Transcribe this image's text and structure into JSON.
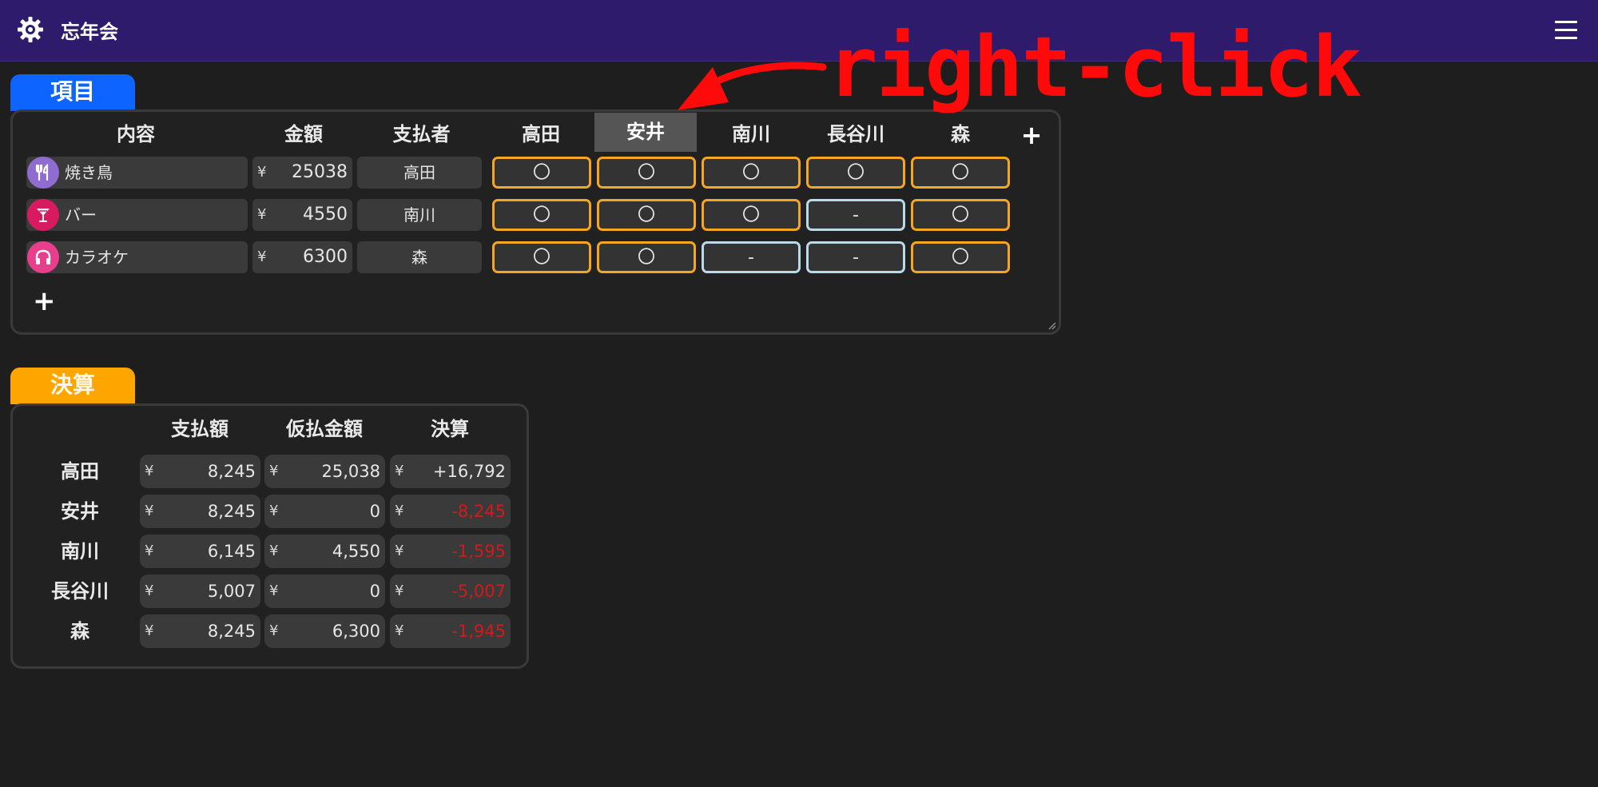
{
  "header": {
    "title": "忘年会",
    "settings_icon": "gear-icon",
    "menu_icon": "hamburger-menu-icon",
    "bg_color": "#2e1b6b"
  },
  "items_section": {
    "tab_label": "項目",
    "tab_color": "#0d64ff",
    "columns": {
      "content": "内容",
      "amount": "金額",
      "payer": "支払者"
    },
    "members": [
      "高田",
      "安井",
      "南川",
      "長谷川",
      "森"
    ],
    "highlighted_member": "安井",
    "add_member_label": "+",
    "add_item_label": "+",
    "rows": [
      {
        "name": "焼き鳥",
        "icon": "fork-knife-icon",
        "icon_color": "#8e6cd0",
        "currency": "¥",
        "amount": "25038",
        "payer": "高田",
        "participation": [
          "〇",
          "〇",
          "〇",
          "〇",
          "〇"
        ],
        "states": [
          true,
          true,
          true,
          true,
          true
        ]
      },
      {
        "name": "バー",
        "icon": "cocktail-icon",
        "icon_color": "#d81b60",
        "currency": "¥",
        "amount": "4550",
        "payer": "南川",
        "participation": [
          "〇",
          "〇",
          "〇",
          "-",
          "〇"
        ],
        "states": [
          true,
          true,
          true,
          false,
          true
        ]
      },
      {
        "name": "カラオケ",
        "icon": "headphones-icon",
        "icon_color": "#e83e8c",
        "currency": "¥",
        "amount": "6300",
        "payer": "森",
        "participation": [
          "〇",
          "〇",
          "-",
          "-",
          "〇"
        ],
        "states": [
          true,
          true,
          false,
          false,
          true
        ]
      }
    ]
  },
  "settlement_section": {
    "tab_label": "決算",
    "tab_color": "#ffa500",
    "columns": [
      "支払額",
      "仮払金額",
      "決算"
    ],
    "rows": [
      {
        "name": "高田",
        "currency": "¥",
        "pay": "8,245",
        "advance": "25,038",
        "balance": "+16,792",
        "negative": false
      },
      {
        "name": "安井",
        "currency": "¥",
        "pay": "8,245",
        "advance": "0",
        "balance": "-8,245",
        "negative": true
      },
      {
        "name": "南川",
        "currency": "¥",
        "pay": "6,145",
        "advance": "4,550",
        "balance": "-1,595",
        "negative": true
      },
      {
        "name": "長谷川",
        "currency": "¥",
        "pay": "5,007",
        "advance": "0",
        "balance": "-5,007",
        "negative": true
      },
      {
        "name": "森",
        "currency": "¥",
        "pay": "8,245",
        "advance": "6,300",
        "balance": "-1,945",
        "negative": true
      }
    ]
  },
  "annotation": {
    "text": "right-click",
    "color": "#ff0a0a"
  }
}
